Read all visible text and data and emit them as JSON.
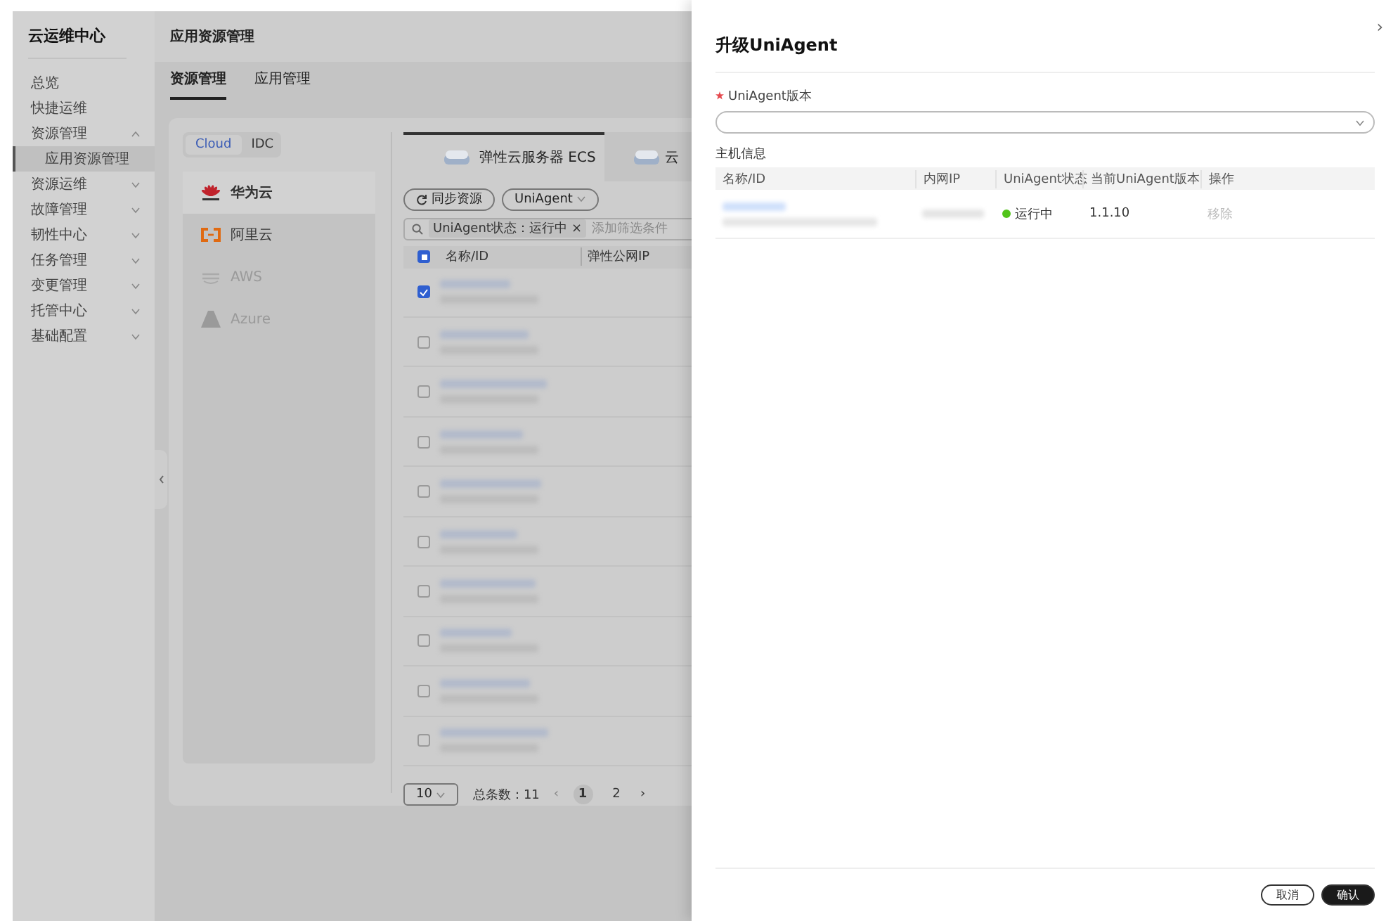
{
  "sidebar": {
    "title": "云运维中心",
    "items": [
      {
        "label": "总览",
        "kind": "link",
        "selected": false
      },
      {
        "label": "快捷运维",
        "kind": "link",
        "selected": false
      },
      {
        "label": "资源管理",
        "kind": "group",
        "expanded": true,
        "selected": false,
        "children": [
          {
            "label": "应用资源管理",
            "selected": true
          }
        ]
      },
      {
        "label": "资源运维",
        "kind": "group",
        "expanded": false,
        "selected": false
      },
      {
        "label": "故障管理",
        "kind": "group",
        "expanded": false,
        "selected": false
      },
      {
        "label": "韧性中心",
        "kind": "group",
        "expanded": false,
        "selected": false
      },
      {
        "label": "任务管理",
        "kind": "group",
        "expanded": false,
        "selected": false
      },
      {
        "label": "变更管理",
        "kind": "group",
        "expanded": false,
        "selected": false
      },
      {
        "label": "托管中心",
        "kind": "group",
        "expanded": false,
        "selected": false
      },
      {
        "label": "基础配置",
        "kind": "group",
        "expanded": false,
        "selected": false
      }
    ]
  },
  "header": {
    "title": "应用资源管理"
  },
  "tabs": [
    {
      "label": "资源管理",
      "selected": true
    },
    {
      "label": "应用管理",
      "selected": false
    }
  ],
  "env_toggle": [
    {
      "label": "Cloud",
      "selected": true
    },
    {
      "label": "IDC",
      "selected": false
    }
  ],
  "providers": [
    {
      "label": "华为云",
      "kind": "huawei",
      "selected": true,
      "disabled": false
    },
    {
      "label": "阿里云",
      "kind": "aliyun",
      "selected": false,
      "disabled": false
    },
    {
      "label": "AWS",
      "kind": "aws",
      "selected": false,
      "disabled": true
    },
    {
      "label": "Azure",
      "kind": "azure",
      "selected": false,
      "disabled": true
    }
  ],
  "resource_tabs": [
    {
      "label": "弹性云服务器 ECS",
      "selected": true
    },
    {
      "label": "云",
      "selected": false
    }
  ],
  "toolbar": {
    "sync_button": "同步资源",
    "agent_dropdown": "UniAgent"
  },
  "filter": {
    "tag": "UniAgent状态：运行中",
    "tag_close": "×",
    "placeholder": "添加筛选条件"
  },
  "table": {
    "select_all": {
      "checked": true,
      "indeterminate": true
    },
    "columns": [
      "名称/ID",
      "弹性公网IP"
    ],
    "rows": [
      {
        "checked": true
      },
      {
        "checked": false
      },
      {
        "checked": false
      },
      {
        "checked": false
      },
      {
        "checked": false
      },
      {
        "checked": false
      },
      {
        "checked": false
      },
      {
        "checked": false
      },
      {
        "checked": false
      },
      {
        "checked": false
      }
    ]
  },
  "pagination": {
    "page_size": "10",
    "total": "总条数：11",
    "prev": "‹",
    "next": "›",
    "pages": [
      {
        "label": "1",
        "selected": true
      },
      {
        "label": "2",
        "selected": false
      }
    ]
  },
  "drawer": {
    "title": "升级UniAgent",
    "close": "›",
    "version_field": {
      "label": "UniAgent版本",
      "required": true
    },
    "section": "主机信息",
    "columns": [
      "名称/ID",
      "内网IP",
      "UniAgent状态",
      "当前UniAgent版本",
      "操作"
    ],
    "rows": [
      {
        "status": "运行中",
        "color": "#52c41a",
        "version": "1.1.10",
        "action": "移除",
        "action_disabled": true
      }
    ],
    "buttons": {
      "cancel": "取消",
      "confirm": "确认"
    }
  }
}
